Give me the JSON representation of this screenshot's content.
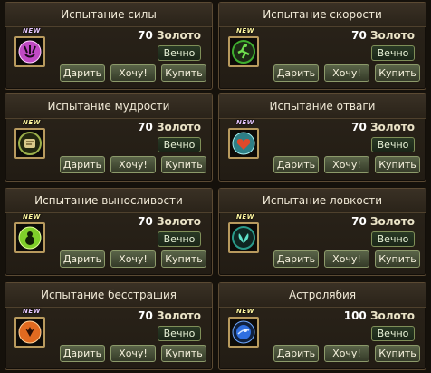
{
  "labels": {
    "gift": "Дарить",
    "want": "Хочу!",
    "buy": "Купить",
    "new": "NEW"
  },
  "items": [
    {
      "title": "Испытание силы",
      "price": "70",
      "currency": "Золото",
      "duration": "Вечно",
      "icon": "trident-icon",
      "icon_color": "#c04ac4",
      "new_color": "purple"
    },
    {
      "title": "Испытание скорости",
      "price": "70",
      "currency": "Золото",
      "duration": "Вечно",
      "icon": "runner-icon",
      "icon_color": "#3fae2f",
      "new_color": "yellow"
    },
    {
      "title": "Испытание мудрости",
      "price": "70",
      "currency": "Золото",
      "duration": "Вечно",
      "icon": "scroll-icon",
      "icon_color": "#9bb04a",
      "new_color": "yellow"
    },
    {
      "title": "Испытание отваги",
      "price": "70",
      "currency": "Золото",
      "duration": "Вечно",
      "icon": "heart-icon",
      "icon_color": "#2e7f86",
      "new_color": "purple"
    },
    {
      "title": "Испытание выносливости",
      "price": "70",
      "currency": "Золото",
      "duration": "Вечно",
      "icon": "gourd-icon",
      "icon_color": "#7fcf2a",
      "new_color": "yellow"
    },
    {
      "title": "Испытание ловкости",
      "price": "70",
      "currency": "Золото",
      "duration": "Вечно",
      "icon": "leaf-icon",
      "icon_color": "#2a9a8a",
      "new_color": "yellow"
    },
    {
      "title": "Испытание бесстрашия",
      "price": "70",
      "currency": "Золото",
      "duration": "Вечно",
      "icon": "flame-shield-icon",
      "icon_color": "#e06a20",
      "new_color": "purple"
    },
    {
      "title": "Астролябия",
      "price": "100",
      "currency": "Золото",
      "duration": "Вечно",
      "icon": "astrolabe-icon",
      "icon_color": "#2f6fe0",
      "new_color": "yellow"
    }
  ]
}
